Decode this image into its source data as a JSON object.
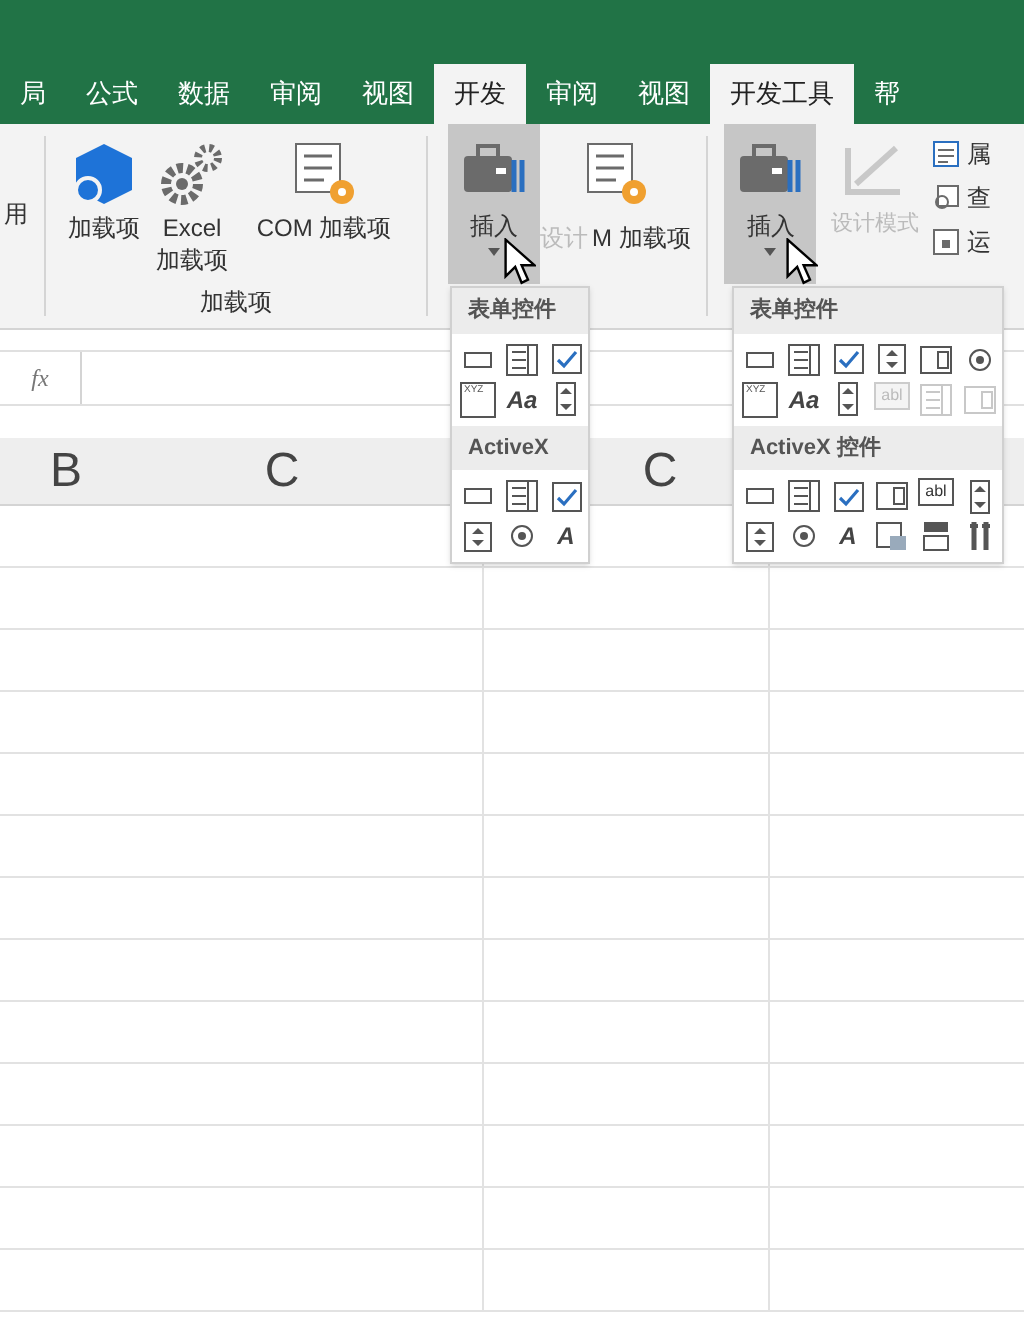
{
  "tabs": [
    {
      "label": "局",
      "selected": false
    },
    {
      "label": "公式",
      "selected": false
    },
    {
      "label": "数据",
      "selected": false
    },
    {
      "label": "审阅",
      "selected": false
    },
    {
      "label": "视图",
      "selected": false
    },
    {
      "label": "开发",
      "selected": true
    },
    {
      "label": "审阅",
      "selected": false
    },
    {
      "label": "视图",
      "selected": false
    },
    {
      "label": "开发工具",
      "selected": true
    },
    {
      "label": "帮",
      "selected": false
    }
  ],
  "ribbon": {
    "cut_label": "用",
    "addins_group": {
      "label": "加载项",
      "buttons": [
        {
          "kind": "cube",
          "label": "加载项"
        },
        {
          "kind": "gears",
          "label": "Excel 加载项"
        },
        {
          "kind": "list-gear",
          "label": "COM 加载项"
        }
      ]
    },
    "panel_a": {
      "insert": {
        "label": "插入",
        "pressed": true
      },
      "design": {
        "label": "设计",
        "disabled": true
      },
      "com": {
        "label": "M 加载项"
      }
    },
    "panel_b": {
      "insert": {
        "label": "插入",
        "pressed": true
      },
      "design": {
        "label": "设计模式",
        "disabled": true
      },
      "side": [
        {
          "kind": "properties",
          "label": "属"
        },
        {
          "kind": "view-code",
          "label": "查"
        },
        {
          "kind": "run",
          "label": "运"
        }
      ]
    }
  },
  "formula_bar": {
    "fx": "fx"
  },
  "column_headers": [
    {
      "label": "B"
    },
    {
      "label": "C"
    },
    {
      "label": "C"
    }
  ],
  "dropdowns": [
    {
      "form_header": "表单控件",
      "activex_header": "ActiveX",
      "form_rows": [
        [
          {
            "kind": "button"
          },
          {
            "kind": "list"
          },
          {
            "kind": "check"
          }
        ],
        [
          {
            "kind": "group",
            "text": "XYZ"
          },
          {
            "kind": "label",
            "text": "Aa"
          },
          {
            "kind": "scroll"
          }
        ]
      ],
      "activex_rows": [
        [
          {
            "kind": "button"
          },
          {
            "kind": "list"
          },
          {
            "kind": "check"
          }
        ],
        [
          {
            "kind": "spin"
          },
          {
            "kind": "radio"
          },
          {
            "kind": "label",
            "text": "A"
          }
        ]
      ]
    },
    {
      "form_header": "表单控件",
      "activex_header": "ActiveX 控件",
      "form_rows": [
        [
          {
            "kind": "button"
          },
          {
            "kind": "list"
          },
          {
            "kind": "check"
          },
          {
            "kind": "spin"
          },
          {
            "kind": "combo"
          },
          {
            "kind": "radio"
          }
        ],
        [
          {
            "kind": "group",
            "text": "XYZ"
          },
          {
            "kind": "label",
            "text": "Aa"
          },
          {
            "kind": "scroll"
          },
          {
            "kind": "textbox",
            "text": "abl",
            "disabled": true
          },
          {
            "kind": "list",
            "disabled": true
          },
          {
            "kind": "combo",
            "disabled": true
          }
        ]
      ],
      "activex_rows": [
        [
          {
            "kind": "button"
          },
          {
            "kind": "list"
          },
          {
            "kind": "check"
          },
          {
            "kind": "combo"
          },
          {
            "kind": "textbox",
            "text": "abl"
          },
          {
            "kind": "scroll"
          }
        ],
        [
          {
            "kind": "spin"
          },
          {
            "kind": "radio"
          },
          {
            "kind": "label",
            "text": "A"
          },
          {
            "kind": "image"
          },
          {
            "kind": "toggle"
          },
          {
            "kind": "tools"
          }
        ]
      ]
    }
  ]
}
